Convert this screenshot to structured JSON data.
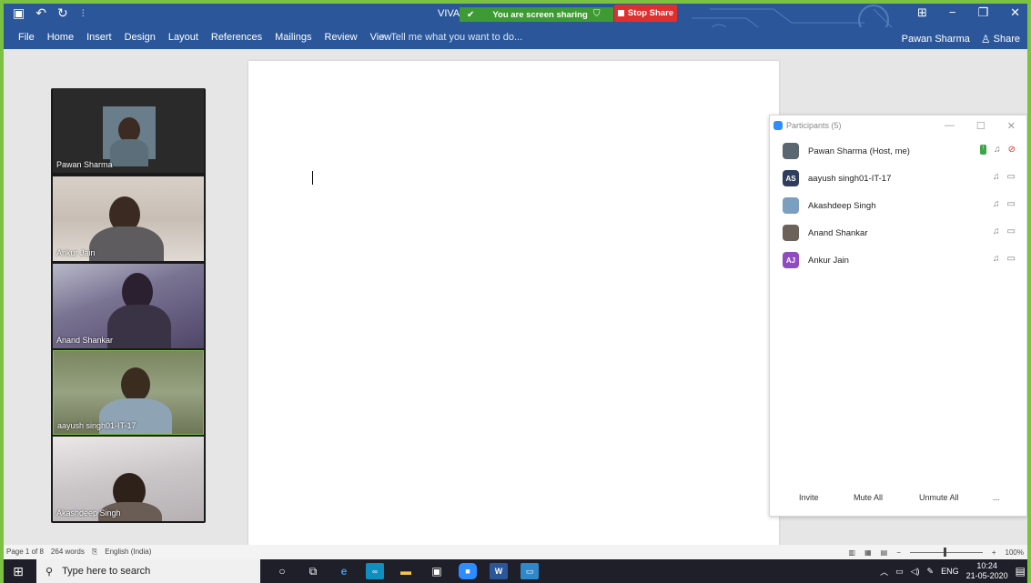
{
  "colors": {
    "word_blue": "#2b579a",
    "share_green": "#3e9a35",
    "stop_red": "#e02f2f",
    "zoom_blue": "#2d8cff",
    "ab_avatar_purple": "#8e4cc0",
    "as_avatar_navy": "#2f3e5d"
  },
  "titlebar": {
    "doc_title": "VIVA",
    "share_banner": "You are screen sharing",
    "stop_share": "Stop Share"
  },
  "ribbon": {
    "tabs": [
      "File",
      "Home",
      "Insert",
      "Design",
      "Layout",
      "References",
      "Mailings",
      "Review",
      "View"
    ],
    "tell_me": "Tell me what you want to do...",
    "user": "Pawan Sharma",
    "share": "Share"
  },
  "gallery": {
    "tiles": [
      {
        "name": "Pawan Sharma"
      },
      {
        "name": "Ankur Jain"
      },
      {
        "name": "Anand Shankar"
      },
      {
        "name": "aayush singh01-IT-17"
      },
      {
        "name": "Akashdeep Singh"
      }
    ]
  },
  "participants": {
    "title": "Participants (5)",
    "list": [
      {
        "name": "Pawan Sharma (Host, me)",
        "avatar": "photo",
        "initials": ""
      },
      {
        "name": "aayush singh01-IT-17",
        "avatar": "initials",
        "initials": "AS"
      },
      {
        "name": "Akashdeep Singh",
        "avatar": "photo",
        "initials": ""
      },
      {
        "name": "Anand Shankar",
        "avatar": "photo",
        "initials": ""
      },
      {
        "name": "Ankur Jain",
        "avatar": "initials",
        "initials": "AJ"
      }
    ],
    "buttons": {
      "invite": "Invite",
      "mute_all": "Mute All",
      "unmute_all": "Unmute All",
      "more": "..."
    }
  },
  "statusbar": {
    "page": "Page 1 of 8",
    "words": "264 words",
    "language": "English (India)",
    "zoom": "100%",
    "zoom_minus": "−",
    "zoom_plus": "+"
  },
  "taskbar": {
    "search": "Type here to search",
    "lang": "ENG",
    "time": "10:24",
    "date": "21-05-2020"
  }
}
